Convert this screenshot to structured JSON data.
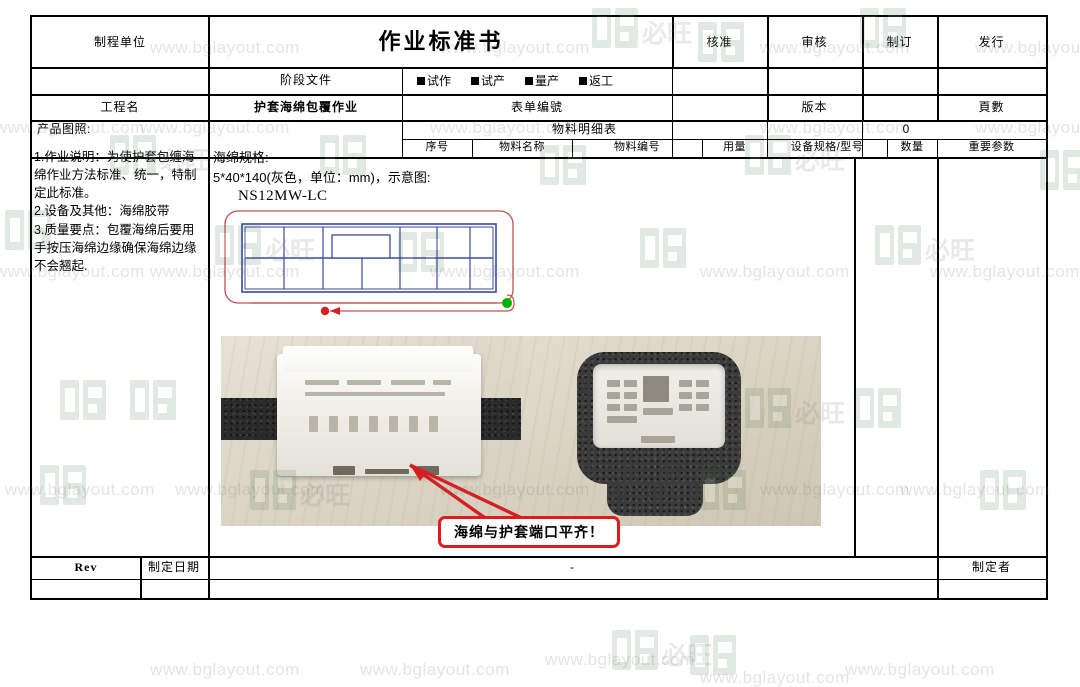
{
  "document": {
    "title": "作业标准书",
    "header": {
      "process_unit_label": "制程单位",
      "process_unit_value": "",
      "stage_file_label": "阶段文件",
      "checkboxes": [
        {
          "label": "试作",
          "checked": true
        },
        {
          "label": "试产",
          "checked": true
        },
        {
          "label": "量产",
          "checked": true
        },
        {
          "label": "返工",
          "checked": true
        }
      ],
      "approval_columns": [
        {
          "label": "核准",
          "value": ""
        },
        {
          "label": "审核",
          "value": ""
        },
        {
          "label": "制订",
          "value": ""
        },
        {
          "label": "发行",
          "value": ""
        }
      ]
    },
    "meta": {
      "process_name_label": "工程名",
      "process_name_value": "护套海绵包覆作业",
      "form_no_label": "表单编號",
      "form_no_value": "",
      "version_label": "版本",
      "version_value": "",
      "pages_label": "頁數",
      "pages_value": ""
    },
    "product_photo_label": "产品图照:",
    "bom": {
      "title": "物料明细表",
      "count": "0",
      "columns": [
        "序号",
        "物料名称",
        "物料编号",
        "用量",
        "设备规格/型号",
        "数量",
        "重要参数"
      ],
      "rows": [
        [
          "",
          "",
          "",
          "",
          "",
          "",
          ""
        ]
      ]
    },
    "instructions": [
      "1.作业说明：为使护套包缠海绵作业方法标准、统一，特制定此标准。",
      "2.设备及其他：海绵胶带",
      "3.质量要点：包覆海绵后要用手按压海绵边缘确保海绵边缘不会翘起."
    ],
    "spec": {
      "line1": "海绵规格:",
      "line2": "5*40*140(灰色，单位：mm)，示意图:",
      "part_number": "NS12MW-LC"
    },
    "callout": {
      "text": "海绵与护套端口平齐！",
      "color": "#e01b1b"
    },
    "footer": {
      "rev_label": "Rev",
      "date_label": "制定日期",
      "center_value": "-",
      "author_label": "制定者",
      "rev_value": "",
      "date_value": "",
      "author_value": ""
    }
  },
  "watermark": {
    "url_text": "www.bglayout.com",
    "brand_cn": "必旺",
    "logo_name": "bg-logo-icon"
  }
}
